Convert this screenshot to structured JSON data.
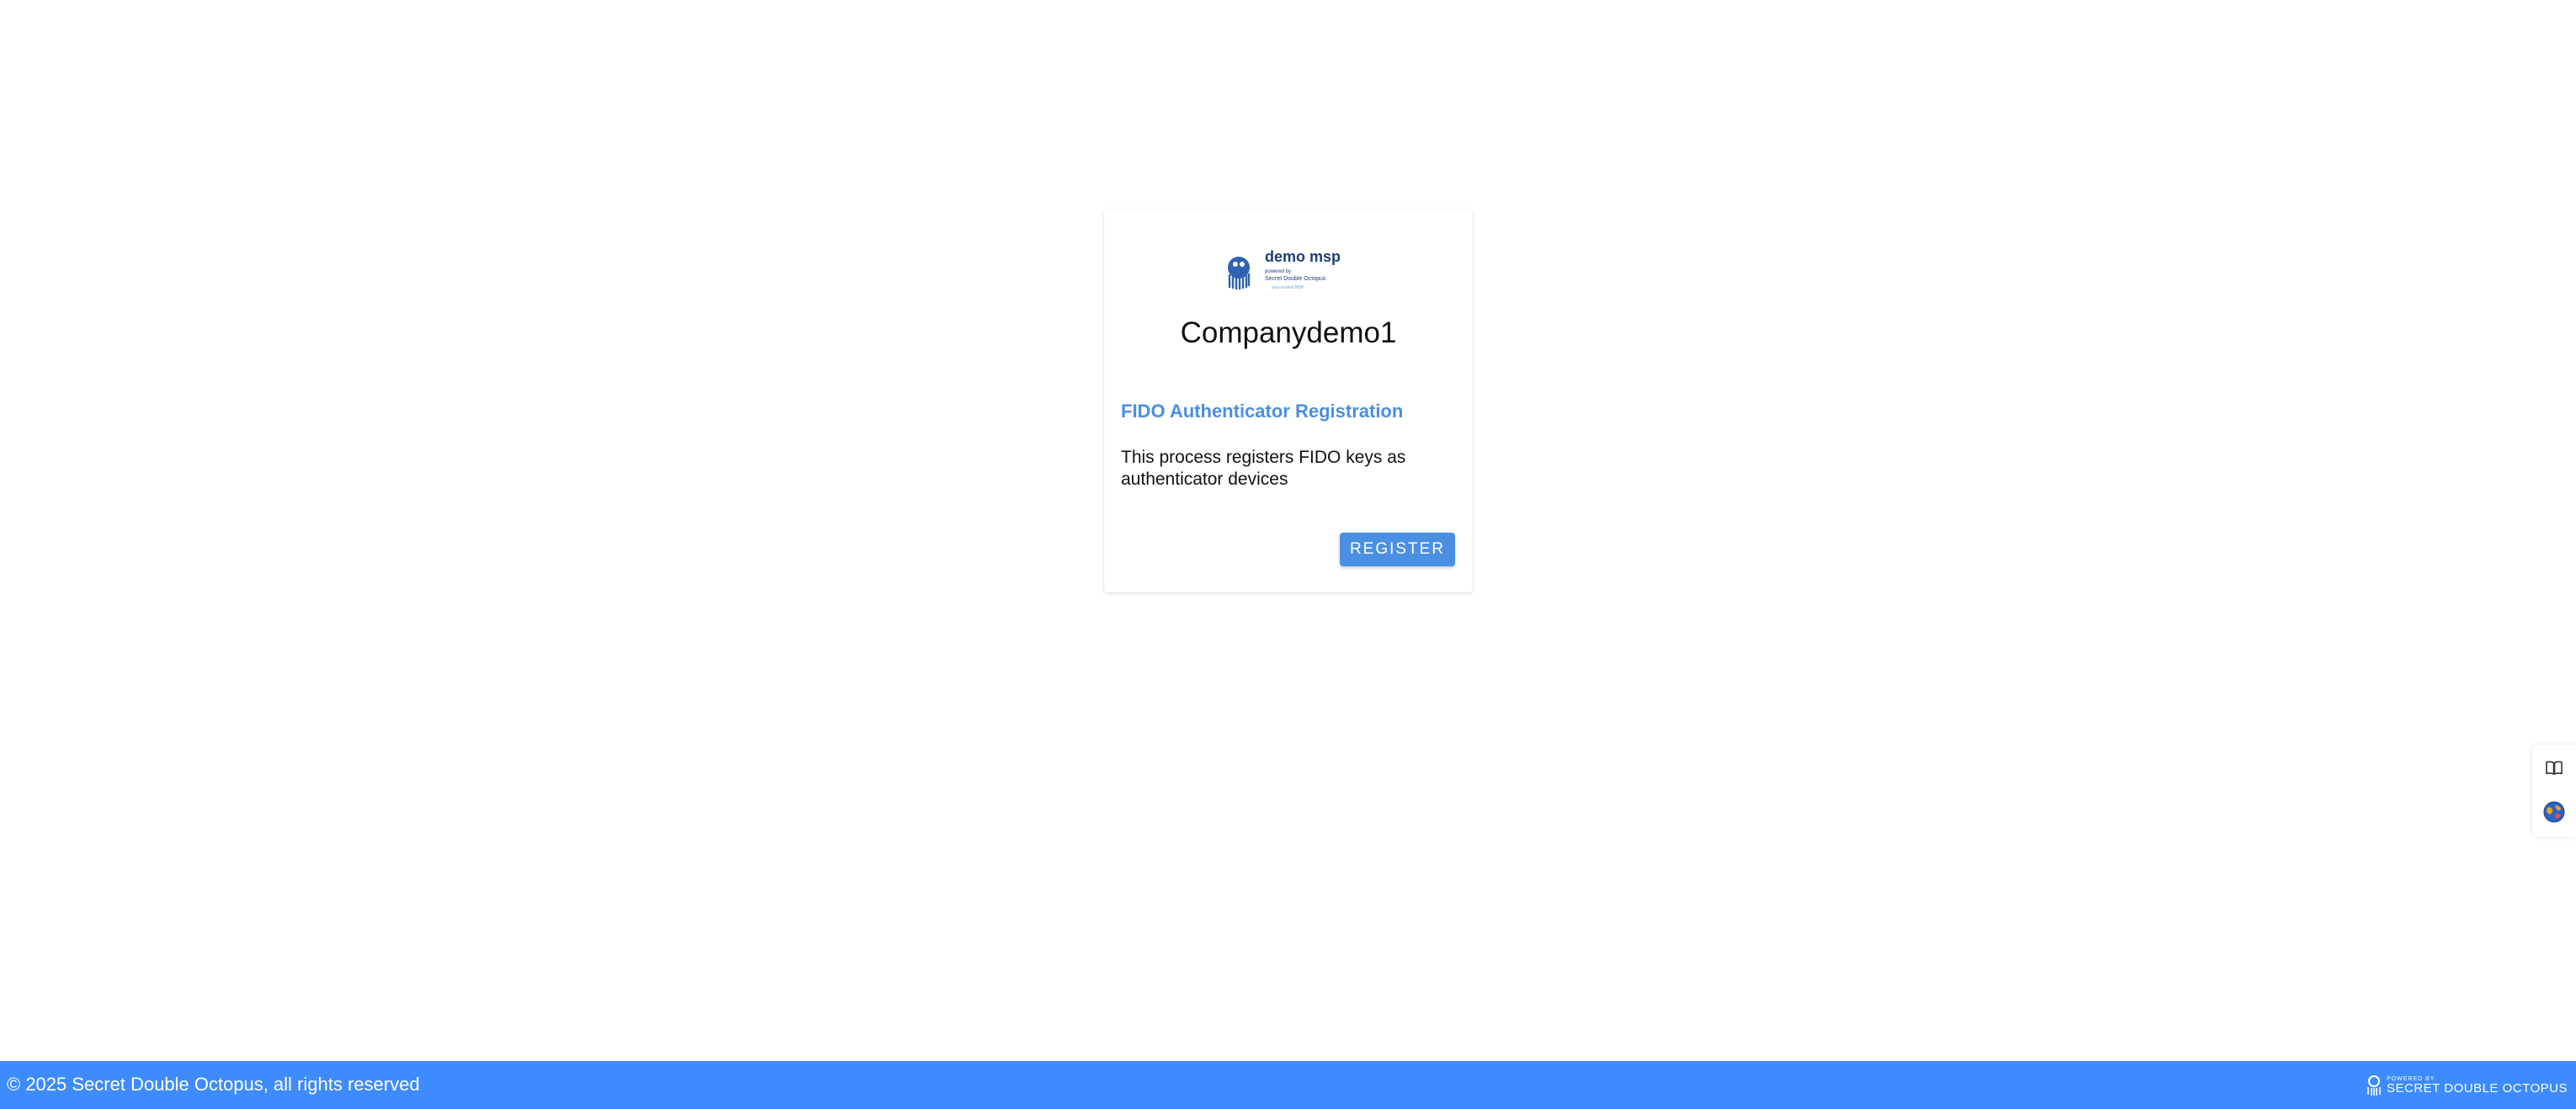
{
  "logo": {
    "title": "demo msp",
    "line1": "powered by",
    "line2": "Secret Double Octopus",
    "line3": "your trusted MSP"
  },
  "card": {
    "company_name": "Companydemo1",
    "heading": "FIDO Authenticator Registration",
    "description": "This process registers FIDO keys as authenticator devices",
    "register_button": "REGISTER"
  },
  "side_widget": {
    "icons": [
      "book-icon",
      "globe-icon"
    ]
  },
  "footer": {
    "copyright": "© 2025 Secret Double Octopus, all rights reserved",
    "powered_small": "POWERED BY",
    "powered_brand": "SECRET DOUBLE OCTOPUS"
  },
  "colors": {
    "accent": "#4a90e2",
    "footer_bg": "#3d8bfd",
    "logo_navy": "#1c3f7a"
  }
}
